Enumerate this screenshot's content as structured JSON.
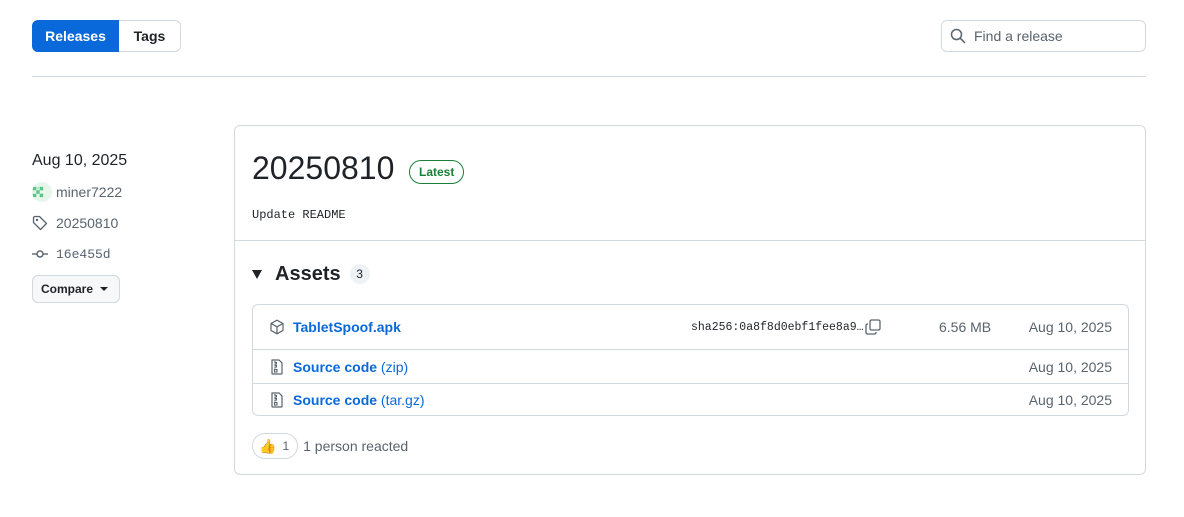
{
  "tabs": [
    {
      "label": "Releases",
      "active": true
    },
    {
      "label": "Tags",
      "active": false
    }
  ],
  "search": {
    "placeholder": "Find a release",
    "icon": "search-icon"
  },
  "sidebar": {
    "date": "Aug 10, 2025",
    "author": "miner7222",
    "tag": "20250810",
    "commit": "16e455d",
    "compare_label": "Compare"
  },
  "release": {
    "title": "20250810",
    "badge": "Latest",
    "description": "Update README",
    "assets_label": "Assets",
    "assets_count": "3",
    "assets": [
      {
        "name": "TabletSpoof.apk",
        "sha": "sha256:0a8f8d0ebf1fee8a9…",
        "size": "6.56 MB",
        "date": "Aug 10, 2025",
        "icon": "package-icon"
      },
      {
        "name": "Source code",
        "suffix": "(zip)",
        "date": "Aug 10, 2025",
        "icon": "file-zip-icon"
      },
      {
        "name": "Source code",
        "suffix": "(tar.gz)",
        "date": "Aug 10, 2025",
        "icon": "file-zip-icon"
      }
    ],
    "reaction": {
      "emoji": "👍",
      "count": "1",
      "text": "1 person reacted"
    }
  },
  "colors": {
    "accent": "#0969da",
    "success": "#1a7f37",
    "border": "#d1d9e0",
    "muted": "#59636e"
  }
}
